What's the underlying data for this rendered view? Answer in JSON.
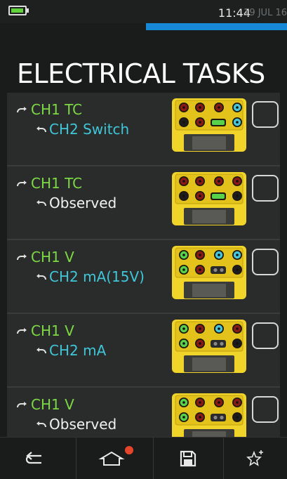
{
  "status": {
    "clock": "11:44",
    "date": "19 JUL 16",
    "battery_level": 0.8,
    "progress": 0.5
  },
  "page": {
    "title": "ELECTRICAL TASKS"
  },
  "tasks": [
    {
      "line1": "CH1 TC",
      "line1_color": "green",
      "line2": "CH2 Switch",
      "line2_color": "cyan",
      "terminals": "tc-switch"
    },
    {
      "line1": "CH1 TC",
      "line1_color": "green",
      "line2": "Observed",
      "line2_color": "white",
      "terminals": "tc-observed"
    },
    {
      "line1": "CH1 V",
      "line1_color": "green",
      "line2": "CH2 mA(15V)",
      "line2_color": "cyan",
      "terminals": "v-ma15"
    },
    {
      "line1": "CH1 V",
      "line1_color": "green",
      "line2": "CH2 mA",
      "line2_color": "cyan",
      "terminals": "v-ma"
    },
    {
      "line1": "CH1 V",
      "line1_color": "green",
      "line2": "Observed",
      "line2_color": "white",
      "terminals": "v-observed"
    }
  ],
  "icons": {
    "arrow_out": "arrow-out-icon",
    "arrow_in": "arrow-in-icon",
    "back": "back-icon",
    "home": "home-icon",
    "save": "save-icon",
    "favorite": "star-plus-icon"
  },
  "colors": {
    "green": "#7cd944",
    "cyan": "#3fc6d8",
    "accent_blue": "#1688d6",
    "device_yellow": "#f1d42a",
    "notification_red": "#e5452a"
  }
}
